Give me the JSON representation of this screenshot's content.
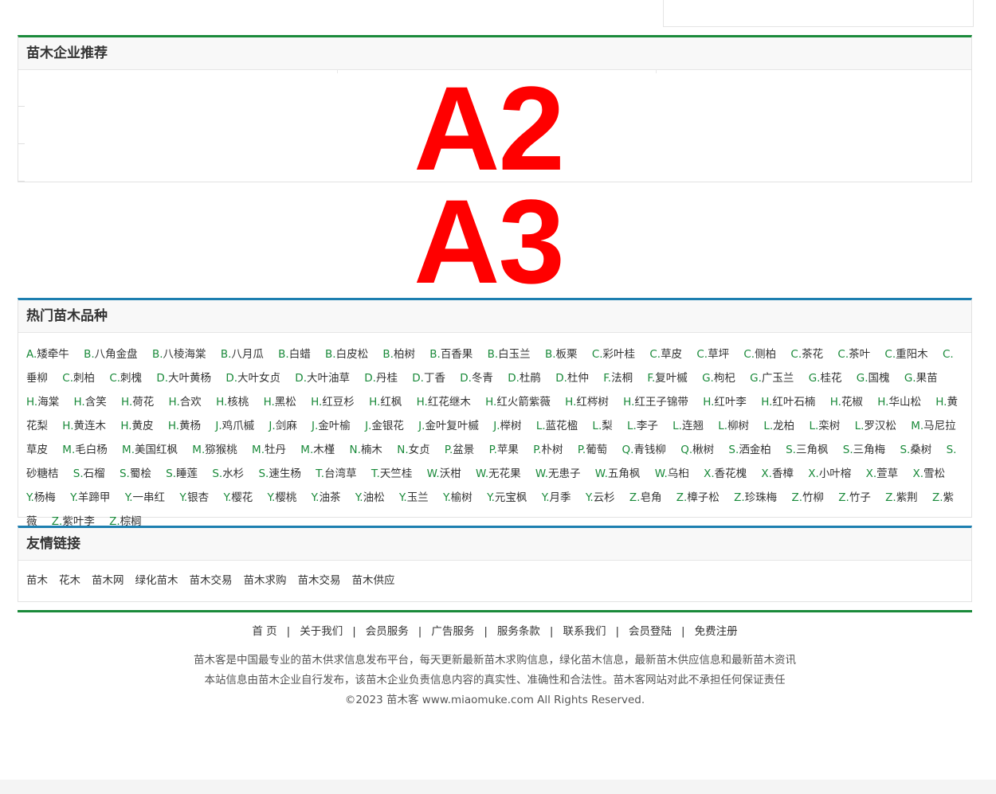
{
  "enterprise": {
    "title": "苗木企业推荐"
  },
  "ads": {
    "a2": "A2",
    "a3": "A3",
    "color": "#ff0000"
  },
  "varieties": {
    "title": "热门苗木品种",
    "items": [
      {
        "letter": "A.",
        "name": "矮牵牛"
      },
      {
        "letter": "B.",
        "name": "八角金盘"
      },
      {
        "letter": "B.",
        "name": "八棱海棠"
      },
      {
        "letter": "B.",
        "name": "八月瓜"
      },
      {
        "letter": "B.",
        "name": "白蜡"
      },
      {
        "letter": "B.",
        "name": "白皮松"
      },
      {
        "letter": "B.",
        "name": "柏树"
      },
      {
        "letter": "B.",
        "name": "百香果"
      },
      {
        "letter": "B.",
        "name": "白玉兰"
      },
      {
        "letter": "B.",
        "name": "板栗"
      },
      {
        "letter": "C.",
        "name": "彩叶桂"
      },
      {
        "letter": "C.",
        "name": "草皮"
      },
      {
        "letter": "C.",
        "name": "草坪"
      },
      {
        "letter": "C.",
        "name": "侧柏"
      },
      {
        "letter": "C.",
        "name": "茶花"
      },
      {
        "letter": "C.",
        "name": "茶叶"
      },
      {
        "letter": "C.",
        "name": "重阳木"
      },
      {
        "letter": "C.",
        "name": "垂柳"
      },
      {
        "letter": "C.",
        "name": "刺柏"
      },
      {
        "letter": "C.",
        "name": "刺槐"
      },
      {
        "letter": "D.",
        "name": "大叶黄杨"
      },
      {
        "letter": "D.",
        "name": "大叶女贞"
      },
      {
        "letter": "D.",
        "name": "大叶油草"
      },
      {
        "letter": "D.",
        "name": "丹桂"
      },
      {
        "letter": "D.",
        "name": "丁香"
      },
      {
        "letter": "D.",
        "name": "冬青"
      },
      {
        "letter": "D.",
        "name": "杜鹃"
      },
      {
        "letter": "D.",
        "name": "杜仲"
      },
      {
        "letter": "F.",
        "name": "法桐"
      },
      {
        "letter": "F.",
        "name": "复叶槭"
      },
      {
        "letter": "G.",
        "name": "枸杞"
      },
      {
        "letter": "G.",
        "name": "广玉兰"
      },
      {
        "letter": "G.",
        "name": "桂花"
      },
      {
        "letter": "G.",
        "name": "国槐"
      },
      {
        "letter": "G.",
        "name": "果苗"
      },
      {
        "letter": "H.",
        "name": "海棠"
      },
      {
        "letter": "H.",
        "name": "含笑"
      },
      {
        "letter": "H.",
        "name": "荷花"
      },
      {
        "letter": "H.",
        "name": "合欢"
      },
      {
        "letter": "H.",
        "name": "核桃"
      },
      {
        "letter": "H.",
        "name": "黑松"
      },
      {
        "letter": "H.",
        "name": "红豆杉"
      },
      {
        "letter": "H.",
        "name": "红枫"
      },
      {
        "letter": "H.",
        "name": "红花继木"
      },
      {
        "letter": "H.",
        "name": "红火箭紫薇"
      },
      {
        "letter": "H.",
        "name": "红梣树"
      },
      {
        "letter": "H.",
        "name": "红王子锦带"
      },
      {
        "letter": "H.",
        "name": "红叶李"
      },
      {
        "letter": "H.",
        "name": "红叶石楠"
      },
      {
        "letter": "H.",
        "name": "花椒"
      },
      {
        "letter": "H.",
        "name": "华山松"
      },
      {
        "letter": "H.",
        "name": "黄花梨"
      },
      {
        "letter": "H.",
        "name": "黄连木"
      },
      {
        "letter": "H.",
        "name": "黄皮"
      },
      {
        "letter": "H.",
        "name": "黄杨"
      },
      {
        "letter": "J.",
        "name": "鸡爪槭"
      },
      {
        "letter": "J.",
        "name": "剑麻"
      },
      {
        "letter": "J.",
        "name": "金叶榆"
      },
      {
        "letter": "J.",
        "name": "金银花"
      },
      {
        "letter": "J.",
        "name": "金叶复叶槭"
      },
      {
        "letter": "J.",
        "name": "榉树"
      },
      {
        "letter": "L.",
        "name": "蓝花楹"
      },
      {
        "letter": "L.",
        "name": "梨"
      },
      {
        "letter": "L.",
        "name": "李子"
      },
      {
        "letter": "L.",
        "name": "连翘"
      },
      {
        "letter": "L.",
        "name": "柳树"
      },
      {
        "letter": "L.",
        "name": "龙柏"
      },
      {
        "letter": "L.",
        "name": "栾树"
      },
      {
        "letter": "L.",
        "name": "罗汉松"
      },
      {
        "letter": "M.",
        "name": "马尼拉草皮"
      },
      {
        "letter": "M.",
        "name": "毛白杨"
      },
      {
        "letter": "M.",
        "name": "美国红枫"
      },
      {
        "letter": "M.",
        "name": "猕猴桃"
      },
      {
        "letter": "M.",
        "name": "牡丹"
      },
      {
        "letter": "M.",
        "name": "木槿"
      },
      {
        "letter": "N.",
        "name": "楠木"
      },
      {
        "letter": "N.",
        "name": "女贞"
      },
      {
        "letter": "P.",
        "name": "盆景"
      },
      {
        "letter": "P.",
        "name": "苹果"
      },
      {
        "letter": "P.",
        "name": "朴树"
      },
      {
        "letter": "P.",
        "name": "葡萄"
      },
      {
        "letter": "Q.",
        "name": "青钱柳"
      },
      {
        "letter": "Q.",
        "name": "楸树"
      },
      {
        "letter": "S.",
        "name": "洒金柏"
      },
      {
        "letter": "S.",
        "name": "三角枫"
      },
      {
        "letter": "S.",
        "name": "三角梅"
      },
      {
        "letter": "S.",
        "name": "桑树"
      },
      {
        "letter": "S.",
        "name": "砂糖桔"
      },
      {
        "letter": "S.",
        "name": "石榴"
      },
      {
        "letter": "S.",
        "name": "蜀桧"
      },
      {
        "letter": "S.",
        "name": "睡莲"
      },
      {
        "letter": "S.",
        "name": "水杉"
      },
      {
        "letter": "S.",
        "name": "速生杨"
      },
      {
        "letter": "T.",
        "name": "台湾草"
      },
      {
        "letter": "T.",
        "name": "天竺桂"
      },
      {
        "letter": "W.",
        "name": "沃柑"
      },
      {
        "letter": "W.",
        "name": "无花果"
      },
      {
        "letter": "W.",
        "name": "无患子"
      },
      {
        "letter": "W.",
        "name": "五角枫"
      },
      {
        "letter": "W.",
        "name": "乌桕"
      },
      {
        "letter": "X.",
        "name": "香花槐"
      },
      {
        "letter": "X.",
        "name": "香樟"
      },
      {
        "letter": "X.",
        "name": "小叶榕"
      },
      {
        "letter": "X.",
        "name": "萱草"
      },
      {
        "letter": "X.",
        "name": "雪松"
      },
      {
        "letter": "Y.",
        "name": "杨梅"
      },
      {
        "letter": "Y.",
        "name": "羊蹄甲"
      },
      {
        "letter": "Y.",
        "name": "一串红"
      },
      {
        "letter": "Y.",
        "name": "银杏"
      },
      {
        "letter": "Y.",
        "name": "樱花"
      },
      {
        "letter": "Y.",
        "name": "樱桃"
      },
      {
        "letter": "Y.",
        "name": "油茶"
      },
      {
        "letter": "Y.",
        "name": "油松"
      },
      {
        "letter": "Y.",
        "name": "玉兰"
      },
      {
        "letter": "Y.",
        "name": "榆树"
      },
      {
        "letter": "Y.",
        "name": "元宝枫"
      },
      {
        "letter": "Y.",
        "name": "月季"
      },
      {
        "letter": "Y.",
        "name": "云杉"
      },
      {
        "letter": "Z.",
        "name": "皂角"
      },
      {
        "letter": "Z.",
        "name": "樟子松"
      },
      {
        "letter": "Z.",
        "name": "珍珠梅"
      },
      {
        "letter": "Z.",
        "name": "竹柳"
      },
      {
        "letter": "Z.",
        "name": "竹子"
      },
      {
        "letter": "Z.",
        "name": "紫荆"
      },
      {
        "letter": "Z.",
        "name": "紫薇"
      },
      {
        "letter": "Z.",
        "name": "紫叶李"
      },
      {
        "letter": "Z.",
        "name": "棕榈"
      }
    ]
  },
  "friend_links": {
    "title": "友情链接",
    "items": [
      "苗木",
      "花木",
      "苗木网",
      "绿化苗木",
      "苗木交易",
      "苗木求购",
      "苗木交易",
      "苗木供应"
    ]
  },
  "footer": {
    "nav": [
      "首 页",
      "关于我们",
      "会员服务",
      "广告服务",
      "服务条款",
      "联系我们",
      "会员登陆",
      "免费注册"
    ],
    "separator": "|",
    "line1": "苗木客是中国最专业的苗木供求信息发布平台，每天更新最新苗木求购信息，绿化苗木信息，最新苗木供应信息和最新苗木资讯",
    "line2": "本站信息由苗木企业自行发布，该苗木企业负责信息内容的真实性、准确性和合法性。苗木客网站对此不承担任何保证责任",
    "line3": "©2023 苗木客 www.miaomuke.com All Rights Reserved."
  },
  "colors": {
    "green_accent": "#1a8a3a",
    "blue_accent": "#1d7fb0",
    "link_letter": "#1a8a3a"
  }
}
